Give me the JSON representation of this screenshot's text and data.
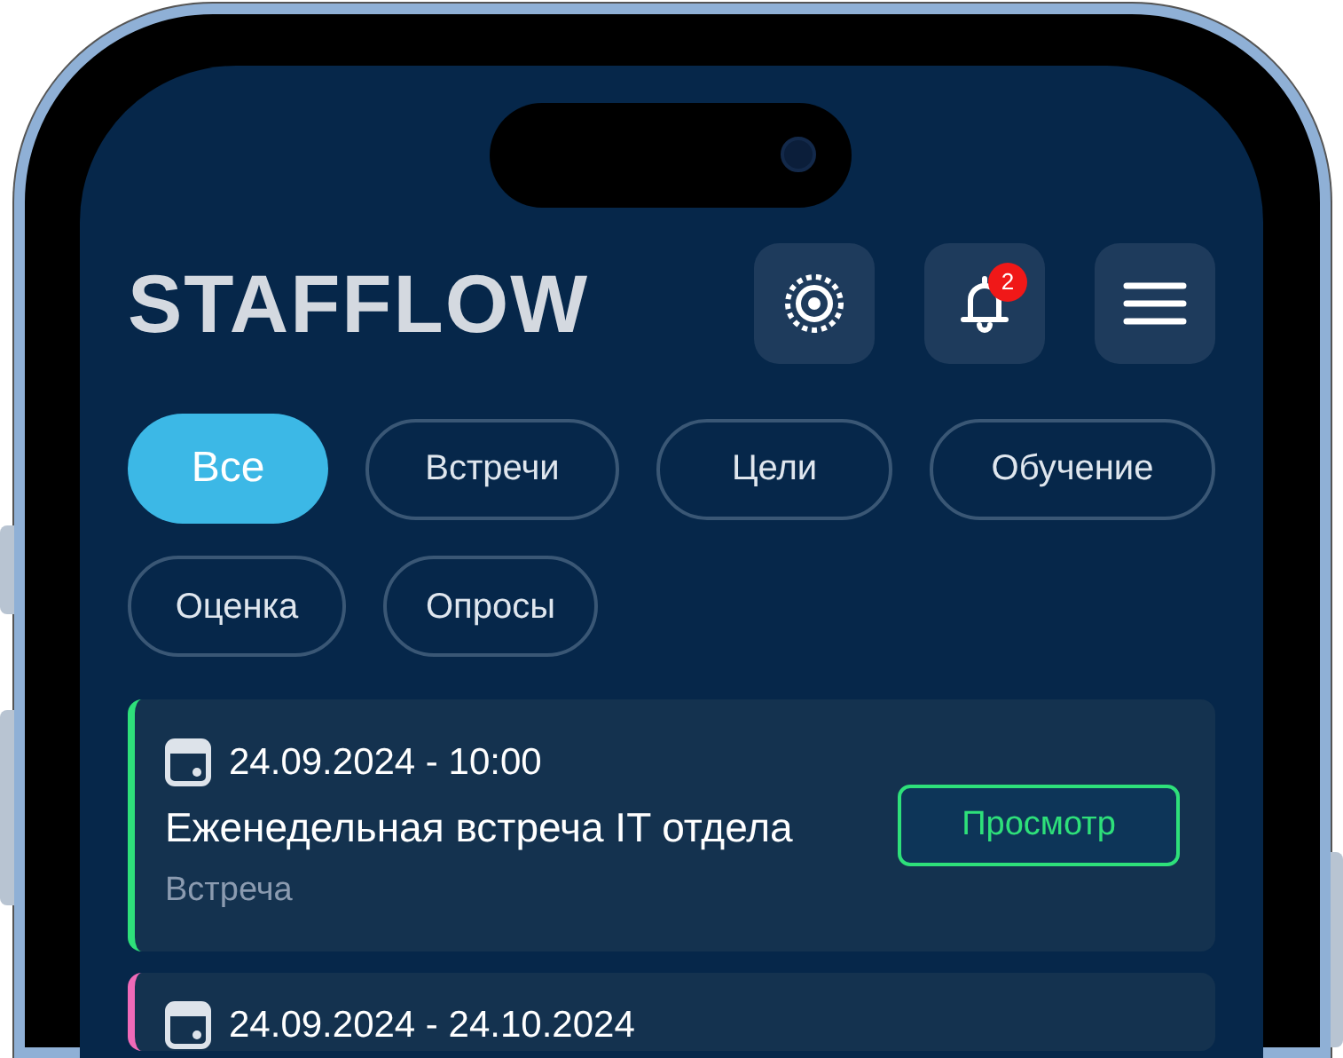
{
  "header": {
    "logo": "STAFFLOW",
    "buttons": [
      {
        "kind": "target"
      },
      {
        "kind": "bell",
        "badge": "2"
      },
      {
        "kind": "menu"
      }
    ]
  },
  "filters": [
    {
      "label": "Все",
      "selected": true
    },
    {
      "label": "Встречи",
      "selected": false
    },
    {
      "label": "Цели",
      "selected": false
    },
    {
      "label": "Обучение",
      "selected": false
    },
    {
      "label": "Оценка",
      "selected": false
    },
    {
      "label": "Опросы",
      "selected": false
    }
  ],
  "events": [
    {
      "date": "24.09.2024 - 10:00",
      "title": "Еженедельная встреча IT отдела",
      "type": "Встреча",
      "action": "Просмотр",
      "color": "#2ee07a"
    },
    {
      "date": "24.09.2024 - 24.10.2024",
      "color": "#f06ab8"
    }
  ]
}
